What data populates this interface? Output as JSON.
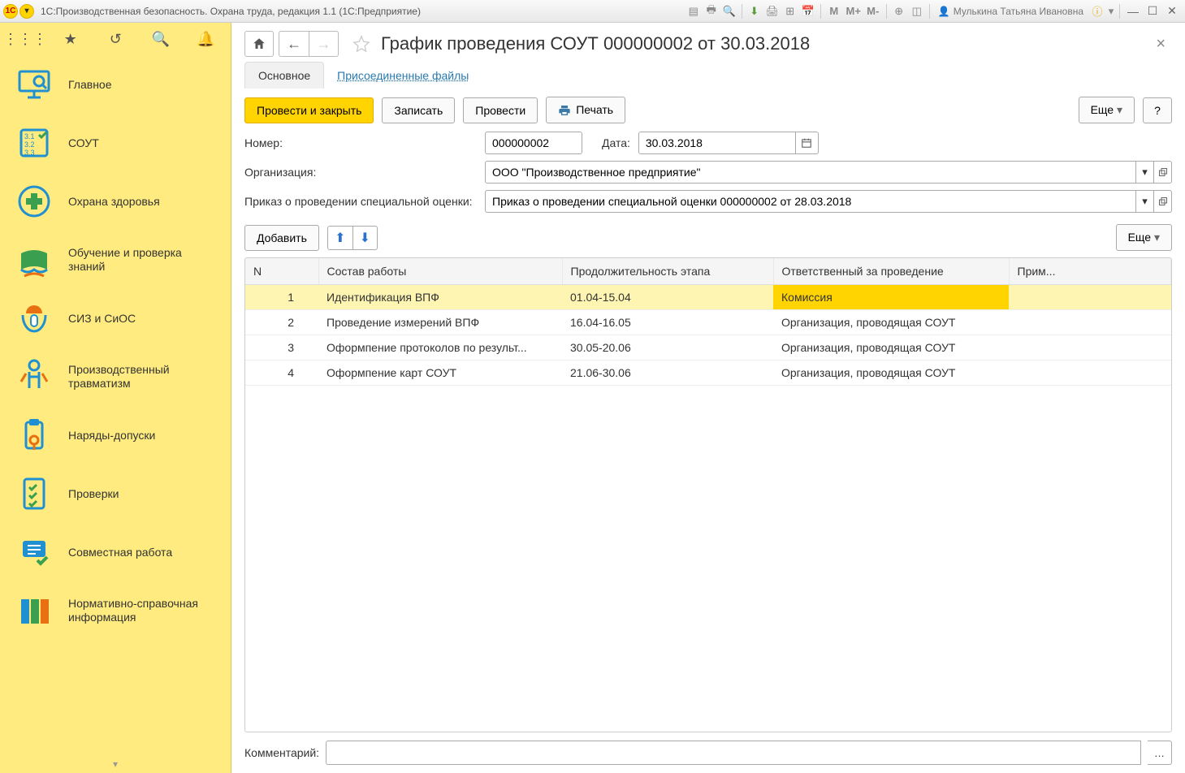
{
  "titlebar": {
    "app_title": "1С:Производственная безопасность. Охрана труда, редакция 1.1  (1С:Предприятие)",
    "m_btns": [
      "М",
      "М+",
      "М-"
    ],
    "user": "Мулькина Татьяна Ивановна"
  },
  "sidebar": {
    "sections": [
      {
        "label": "Главное",
        "icon": "monitor"
      },
      {
        "label": "СОУТ",
        "icon": "list-check"
      },
      {
        "label": "Охрана здоровья",
        "icon": "health"
      },
      {
        "label": "Обучение и проверка знаний",
        "icon": "book"
      },
      {
        "label": "СИЗ и СиОС",
        "icon": "ppe"
      },
      {
        "label": "Производственный травматизм",
        "icon": "injury"
      },
      {
        "label": "Наряды-допуски",
        "icon": "permit"
      },
      {
        "label": "Проверки",
        "icon": "inspect"
      },
      {
        "label": "Совместная работа",
        "icon": "collab"
      },
      {
        "label": "Нормативно-справочная информация",
        "icon": "docs"
      }
    ]
  },
  "page": {
    "title": "График проведения СОУТ 000000002 от 30.03.2018",
    "tabs": {
      "main": "Основное",
      "attached": "Присоединенные файлы"
    },
    "toolbar": {
      "submit_close": "Провести и закрыть",
      "save": "Записать",
      "submit": "Провести",
      "print": "Печать",
      "more": "Еще",
      "help": "?"
    },
    "form": {
      "number_label": "Номер:",
      "number_value": "000000002",
      "date_label": "Дата:",
      "date_value": "30.03.2018",
      "org_label": "Организация:",
      "org_value": "ООО \"Производственное предприятие\"",
      "order_label": "Приказ о проведении специальной оценки:",
      "order_value": "Приказ о проведении специальной оценки 000000002 от 28.03.2018"
    },
    "grid_toolbar": {
      "add": "Добавить",
      "more": "Еще"
    },
    "grid": {
      "cols": {
        "n": "N",
        "work": "Состав работы",
        "dur": "Продолжительность этапа",
        "resp": "Ответственный за проведение",
        "note": "Прим..."
      },
      "rows": [
        {
          "n": "1",
          "work": "Идентификация ВПФ",
          "dur": "01.04-15.04",
          "resp": "Комиссия",
          "note": "",
          "selected": true
        },
        {
          "n": "2",
          "work": "Проведение измерений ВПФ",
          "dur": "16.04-16.05",
          "resp": "Организация, проводящая СОУТ",
          "note": ""
        },
        {
          "n": "3",
          "work": "Оформпение протоколов по результ...",
          "dur": "30.05-20.06",
          "resp": "Организация, проводящая СОУТ",
          "note": ""
        },
        {
          "n": "4",
          "work": "Оформпение карт СОУТ",
          "dur": "21.06-30.06",
          "resp": "Организация, проводящая СОУТ",
          "note": ""
        }
      ]
    },
    "footer": {
      "comment_label": "Комментарий:",
      "comment_value": ""
    }
  }
}
